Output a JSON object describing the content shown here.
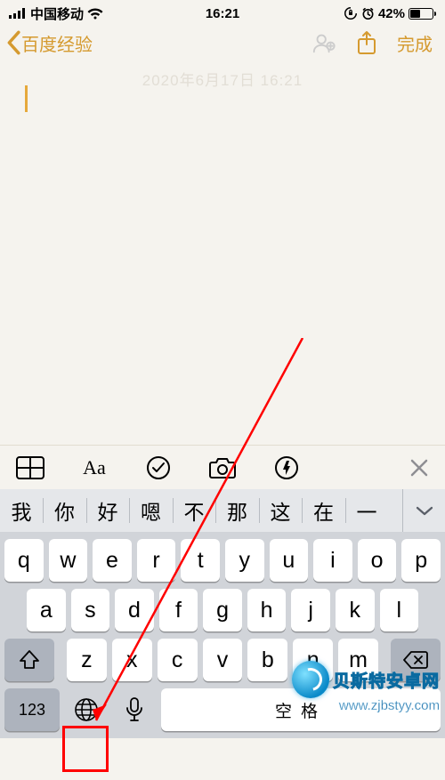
{
  "status": {
    "carrier": "中国移动",
    "time": "16:21",
    "battery_pct": "42%",
    "battery_fill_pct": 42
  },
  "nav": {
    "back_label": "百度经验",
    "done_label": "完成"
  },
  "note": {
    "date_hint": "2020年6月17日 16:21"
  },
  "notes_toolbar": {
    "text_style_label": "Aa"
  },
  "keyboard": {
    "candidates": [
      "我",
      "你",
      "好",
      "嗯",
      "不",
      "那",
      "这",
      "在",
      "一"
    ],
    "row1": [
      "q",
      "w",
      "e",
      "r",
      "t",
      "y",
      "u",
      "i",
      "o",
      "p"
    ],
    "row2": [
      "a",
      "s",
      "d",
      "f",
      "g",
      "h",
      "j",
      "k",
      "l"
    ],
    "row3": [
      "z",
      "x",
      "c",
      "v",
      "b",
      "n",
      "m"
    ],
    "numkey_label": "123",
    "space_label": "空格"
  },
  "watermark": {
    "site_name": "贝斯特安卓网",
    "site_url": "www.zjbstyy.com"
  }
}
